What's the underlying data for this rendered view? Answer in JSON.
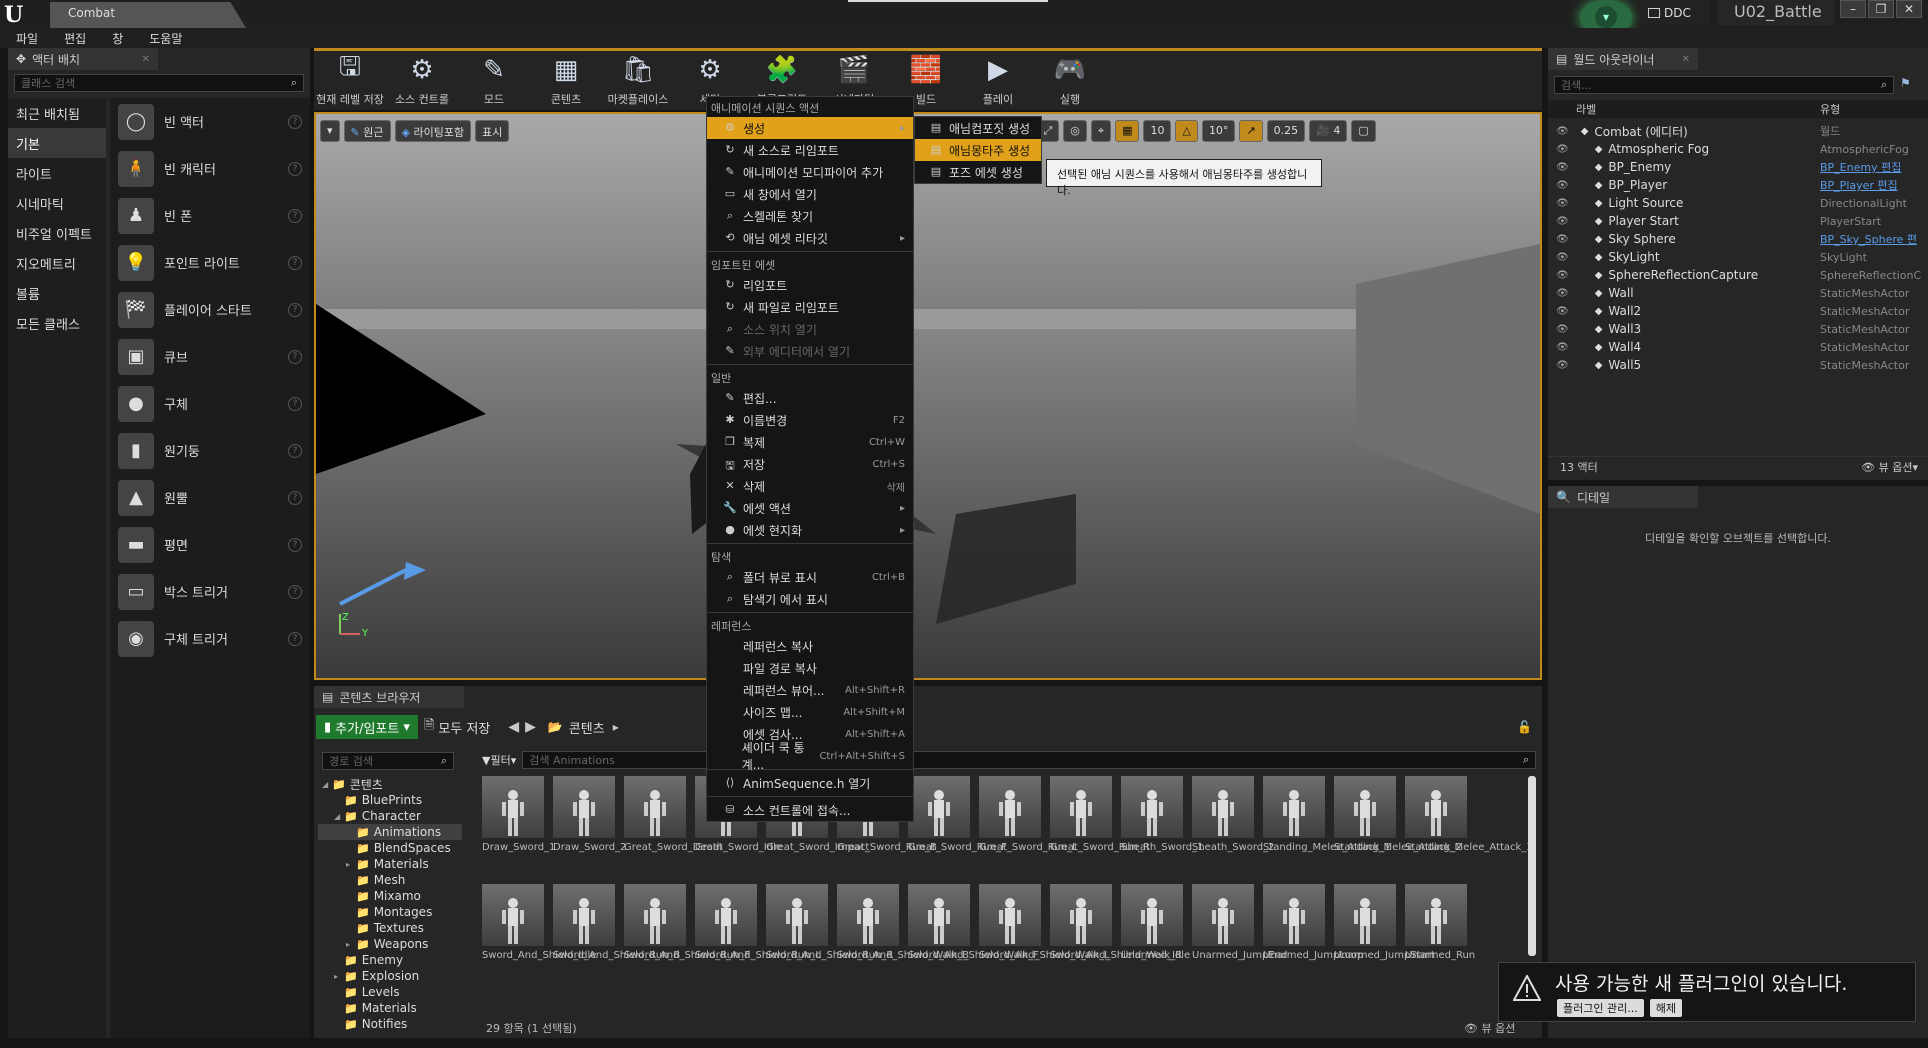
{
  "titlebar": {
    "app_logo": "U",
    "doc_tab": "Combat",
    "ddc": "DDC",
    "project": "U02_Battle",
    "min": "–",
    "max": "❐",
    "close": "✕"
  },
  "menubar": [
    "파일",
    "편집",
    "창",
    "도움말"
  ],
  "place_actors": {
    "tab": "액터 배치",
    "search_placeholder": "클래스 검색",
    "categories": [
      "최근 배치됨",
      "기본",
      "라이트",
      "시네마틱",
      "비주얼 이펙트",
      "지오메트리",
      "볼륨",
      "모든 클래스"
    ],
    "selected_category": "기본",
    "items": [
      "빈 액터",
      "빈 캐릭터",
      "빈 폰",
      "포인트 라이트",
      "플레이어 스타트",
      "큐브",
      "구체",
      "원기둥",
      "원뿔",
      "평면",
      "박스 트리거",
      "구체 트리거"
    ]
  },
  "toolbar": [
    "현재 레벨 저장",
    "소스 컨트롤",
    "모드",
    "콘텐츠",
    "마켓플레이스",
    "세팅",
    "블루프린트",
    "시네마틱",
    "빌드",
    "플레이",
    "실행"
  ],
  "viewport": {
    "buttons": [
      "원근",
      "라이팅포함",
      "표시"
    ],
    "snap_values": [
      "10",
      "10°",
      "0.25",
      "4"
    ],
    "axis_z": "Z",
    "axis_y": "Y"
  },
  "context_menu": {
    "header": "애니메이션 시퀀스 액션",
    "sections": [
      {
        "title": "",
        "items": [
          {
            "label": "생성",
            "icon": "gear-icon",
            "submenu": true,
            "highlight": true
          },
          {
            "label": "새 소스로 리임포트",
            "icon": "reimport-icon"
          },
          {
            "label": "애니메이션 모디파이어 추가",
            "icon": "modifier-icon"
          },
          {
            "label": "새 창에서 열기",
            "icon": "window-icon"
          },
          {
            "label": "스켈레톤 찾기",
            "icon": "search-icon"
          },
          {
            "label": "애님 에셋 리타깃",
            "icon": "retarget-icon",
            "submenu": true
          }
        ]
      },
      {
        "title": "임포트된 에셋",
        "items": [
          {
            "label": "리임포트",
            "icon": "reimport-icon"
          },
          {
            "label": "새 파일로 리임포트",
            "icon": "reimport-icon"
          },
          {
            "label": "소스 위치 열기",
            "icon": "search-icon",
            "disabled": true
          },
          {
            "label": "외부 에디터에서 열기",
            "icon": "edit-icon",
            "disabled": true
          }
        ]
      },
      {
        "title": "일반",
        "items": [
          {
            "label": "편집...",
            "icon": "edit-icon"
          },
          {
            "label": "이름변경",
            "icon": "rename-icon",
            "shortcut": "F2"
          },
          {
            "label": "복제",
            "icon": "duplicate-icon",
            "shortcut": "Ctrl+W"
          },
          {
            "label": "저장",
            "icon": "save-icon",
            "shortcut": "Ctrl+S"
          },
          {
            "label": "삭제",
            "icon": "delete-icon",
            "shortcut": "삭제"
          },
          {
            "label": "에셋 액션",
            "icon": "wrench-icon",
            "submenu": true
          },
          {
            "label": "에셋 현지화",
            "icon": "globe-icon",
            "submenu": true
          }
        ]
      },
      {
        "title": "탐색",
        "items": [
          {
            "label": "폴더 뷰로 표시",
            "icon": "search-icon",
            "shortcut": "Ctrl+B"
          },
          {
            "label": "탐색기 에서 표시",
            "icon": "search-icon"
          }
        ]
      },
      {
        "title": "레퍼런스",
        "items": [
          {
            "label": "레퍼런스 복사"
          },
          {
            "label": "파일 경로 복사"
          },
          {
            "label": "레퍼런스 뷰어...",
            "shortcut": "Alt+Shift+R"
          },
          {
            "label": "사이즈 맵...",
            "shortcut": "Alt+Shift+M"
          },
          {
            "label": "에셋 검사...",
            "shortcut": "Alt+Shift+A"
          },
          {
            "label": "셰이더 쿡 통계...",
            "shortcut": "Ctrl+Alt+Shift+S"
          }
        ]
      },
      {
        "title": "",
        "items": [
          {
            "label": "AnimSequence.h 열기",
            "icon": "code-icon"
          }
        ]
      },
      {
        "title": "",
        "items": [
          {
            "label": "소스 컨트롤에 접속...",
            "icon": "source-control-icon"
          }
        ]
      }
    ]
  },
  "submenu": {
    "items": [
      "애님컴포짓 생성",
      "애님몽타주 생성",
      "포즈 에셋 생성"
    ],
    "highlight": "애님몽타주 생성"
  },
  "tooltip": "선택된 애님 시퀀스를 사용해서 애님몽타주를 생성합니다.",
  "content_browser": {
    "tab": "콘텐츠 브라우저",
    "add_import": "추가/임포트",
    "save_all": "모두 저장",
    "path": "콘텐츠",
    "path_search_placeholder": "경로 검색",
    "filter": "필터",
    "asset_search_placeholder": "검색 Animations",
    "tree": [
      {
        "label": "콘텐츠",
        "level": 0,
        "expanded": true
      },
      {
        "label": "BluePrints",
        "level": 1
      },
      {
        "label": "Character",
        "level": 1,
        "expanded": true
      },
      {
        "label": "Animations",
        "level": 2,
        "selected": true
      },
      {
        "label": "BlendSpaces",
        "level": 2
      },
      {
        "label": "Materials",
        "level": 2,
        "collapsed": true
      },
      {
        "label": "Mesh",
        "level": 2
      },
      {
        "label": "Mixamo",
        "level": 2
      },
      {
        "label": "Montages",
        "level": 2
      },
      {
        "label": "Textures",
        "level": 2
      },
      {
        "label": "Weapons",
        "level": 2,
        "collapsed": true
      },
      {
        "label": "Enemy",
        "level": 1
      },
      {
        "label": "Explosion",
        "level": 1,
        "collapsed": true
      },
      {
        "label": "Levels",
        "level": 1
      },
      {
        "label": "Materials",
        "level": 1
      },
      {
        "label": "Notifies",
        "level": 1
      }
    ],
    "assets_row1": [
      "Draw_Sword_1",
      "Draw_Sword_2",
      "Great_Sword_Death",
      "Great_Sword_Idle",
      "Great_Sword_Impact",
      "Great_Sword_Run_B",
      "Great_Sword_Run_F",
      "Great_Sword_Run_L",
      "Great_Sword_Run_R",
      "Sheath_Sword_1",
      "Sheath_Sword_2",
      "Standing_Melee_Attack_1",
      "Standing_Melee_Attack_2",
      "Standing_Melee_Attack_3"
    ],
    "assets_row2": [
      "Sword_And_Shield_Idle",
      "Sword_And_Shield_Run_B",
      "Sword_And_Shield_Run_F",
      "Sword_And_Shield_Run_L",
      "Sword_And_Shield_Run_R",
      "Sword_And_Shield_Walk_B",
      "Sword_And_Shield_Walk_F",
      "Sword_And_Shield_Walk_L",
      "Sword_And_Shield_Walk_R",
      "Unarmed_Idle",
      "Unarmed_JumpEnd",
      "Unarmed_JumpLoop",
      "Unarmed_JumpStart",
      "Unarmed_Run"
    ],
    "status": "29 항목 (1 선택됨)",
    "view_options": "뷰 옵션"
  },
  "outliner": {
    "tab": "월드 아웃라이너",
    "search_placeholder": "검색...",
    "col_label": "라벨",
    "col_type": "유형",
    "rows": [
      {
        "label": "Combat (에디터)",
        "type": "월드"
      },
      {
        "label": "Atmospheric Fog",
        "type": "AtmosphericFog"
      },
      {
        "label": "BP_Enemy",
        "type": "BP_Enemy 편집",
        "link": true
      },
      {
        "label": "BP_Player",
        "type": "BP_Player 편집",
        "link": true
      },
      {
        "label": "Light Source",
        "type": "DirectionalLight"
      },
      {
        "label": "Player Start",
        "type": "PlayerStart"
      },
      {
        "label": "Sky Sphere",
        "type": "BP_Sky_Sphere 편",
        "link": true
      },
      {
        "label": "SkyLight",
        "type": "SkyLight"
      },
      {
        "label": "SphereReflectionCapture",
        "type": "SphereReflectionC"
      },
      {
        "label": "Wall",
        "type": "StaticMeshActor"
      },
      {
        "label": "Wall2",
        "type": "StaticMeshActor"
      },
      {
        "label": "Wall3",
        "type": "StaticMeshActor"
      },
      {
        "label": "Wall4",
        "type": "StaticMeshActor"
      },
      {
        "label": "Wall5",
        "type": "StaticMeshActor"
      }
    ],
    "count": "13 액터",
    "view_options": "뷰 옵션"
  },
  "details": {
    "tab": "디테일",
    "empty": "디테일을 확인할 오브젝트를 선택합니다."
  },
  "notification": {
    "text": "사용 가능한 새 플러그인이 있습니다.",
    "manage": "플러그인 관리...",
    "dismiss": "해제"
  }
}
